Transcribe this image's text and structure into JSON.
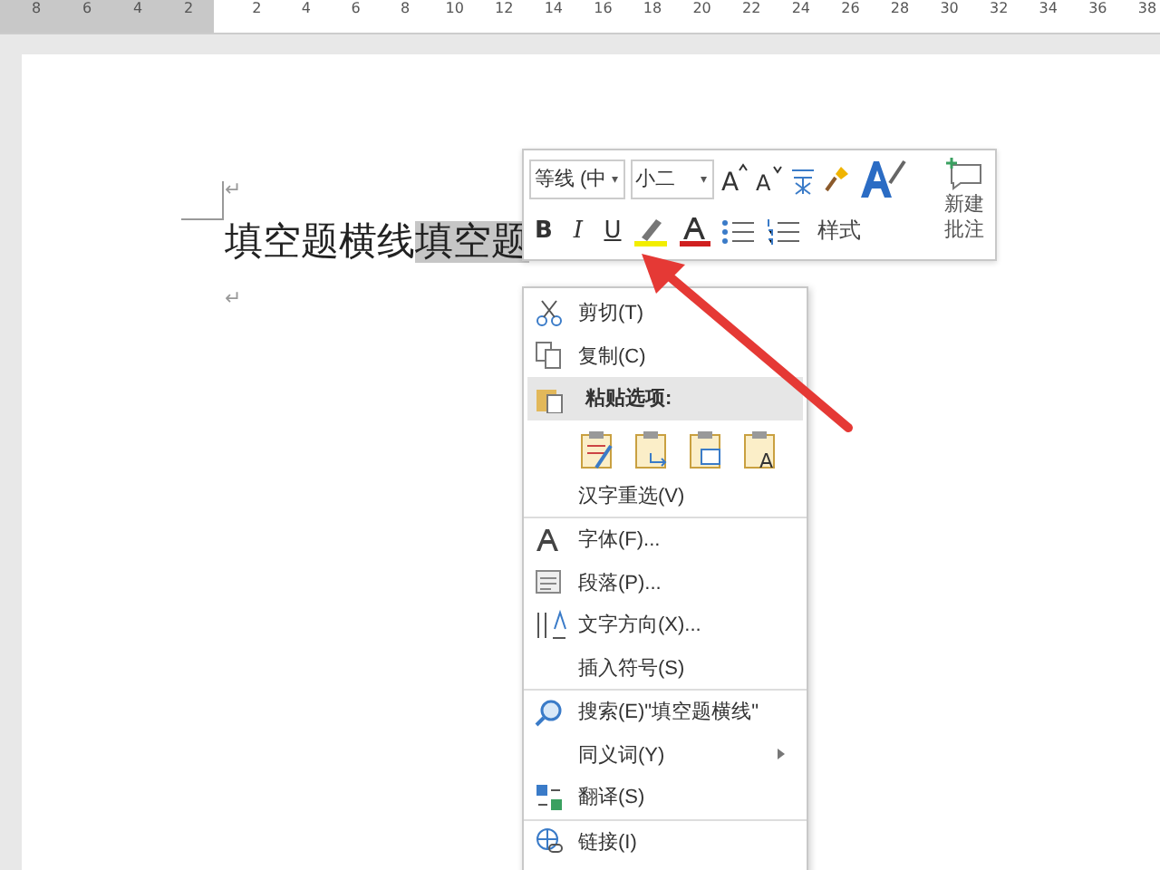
{
  "ruler": {
    "left_labels": [
      "8",
      "6",
      "4",
      "2"
    ],
    "right_labels": [
      "2",
      "4",
      "6",
      "8",
      "10",
      "12",
      "14",
      "16",
      "18",
      "20",
      "22",
      "24",
      "26",
      "28",
      "30",
      "32",
      "34",
      "36",
      "38"
    ]
  },
  "document": {
    "text": "填空题横线",
    "selected_text": "填空题",
    "paragraph_marks": [
      "↵",
      "↵"
    ]
  },
  "mini_toolbar": {
    "font": "等线 (中",
    "font_caret": "▾",
    "size": "小二",
    "size_caret": "▾",
    "grow_font": "A",
    "shrink_font": "A",
    "styles_label": "样式",
    "comment_label": [
      "新建",
      "批注"
    ],
    "bold": "B",
    "italic": "I",
    "underline": "U"
  },
  "context_menu": [
    {
      "kind": "item",
      "label": "剪切(T)",
      "submenu": false,
      "divider": false
    },
    {
      "kind": "item",
      "label": "复制(C)",
      "submenu": false,
      "divider": false
    },
    {
      "kind": "header",
      "label": "粘贴选项:"
    },
    {
      "kind": "paste",
      "text_only_glyph": "A"
    },
    {
      "kind": "item",
      "label": "汉字重选(V)",
      "submenu": false,
      "divider": true
    },
    {
      "kind": "item",
      "label": "字体(F)...",
      "submenu": false,
      "divider": false
    },
    {
      "kind": "item",
      "label": "段落(P)...",
      "submenu": false,
      "divider": false
    },
    {
      "kind": "item",
      "label": "文字方向(X)...",
      "submenu": false,
      "divider": false
    },
    {
      "kind": "item",
      "label": "插入符号(S)",
      "submenu": false,
      "divider": true
    },
    {
      "kind": "item",
      "label": "搜索(E)\"填空题横线\"",
      "submenu": false,
      "divider": false
    },
    {
      "kind": "item",
      "label": "同义词(Y)",
      "submenu": true,
      "divider": false
    },
    {
      "kind": "item",
      "label": "翻译(S)",
      "submenu": false,
      "divider": true
    },
    {
      "kind": "item",
      "label": "链接(I)",
      "submenu": false,
      "divider": false
    }
  ]
}
